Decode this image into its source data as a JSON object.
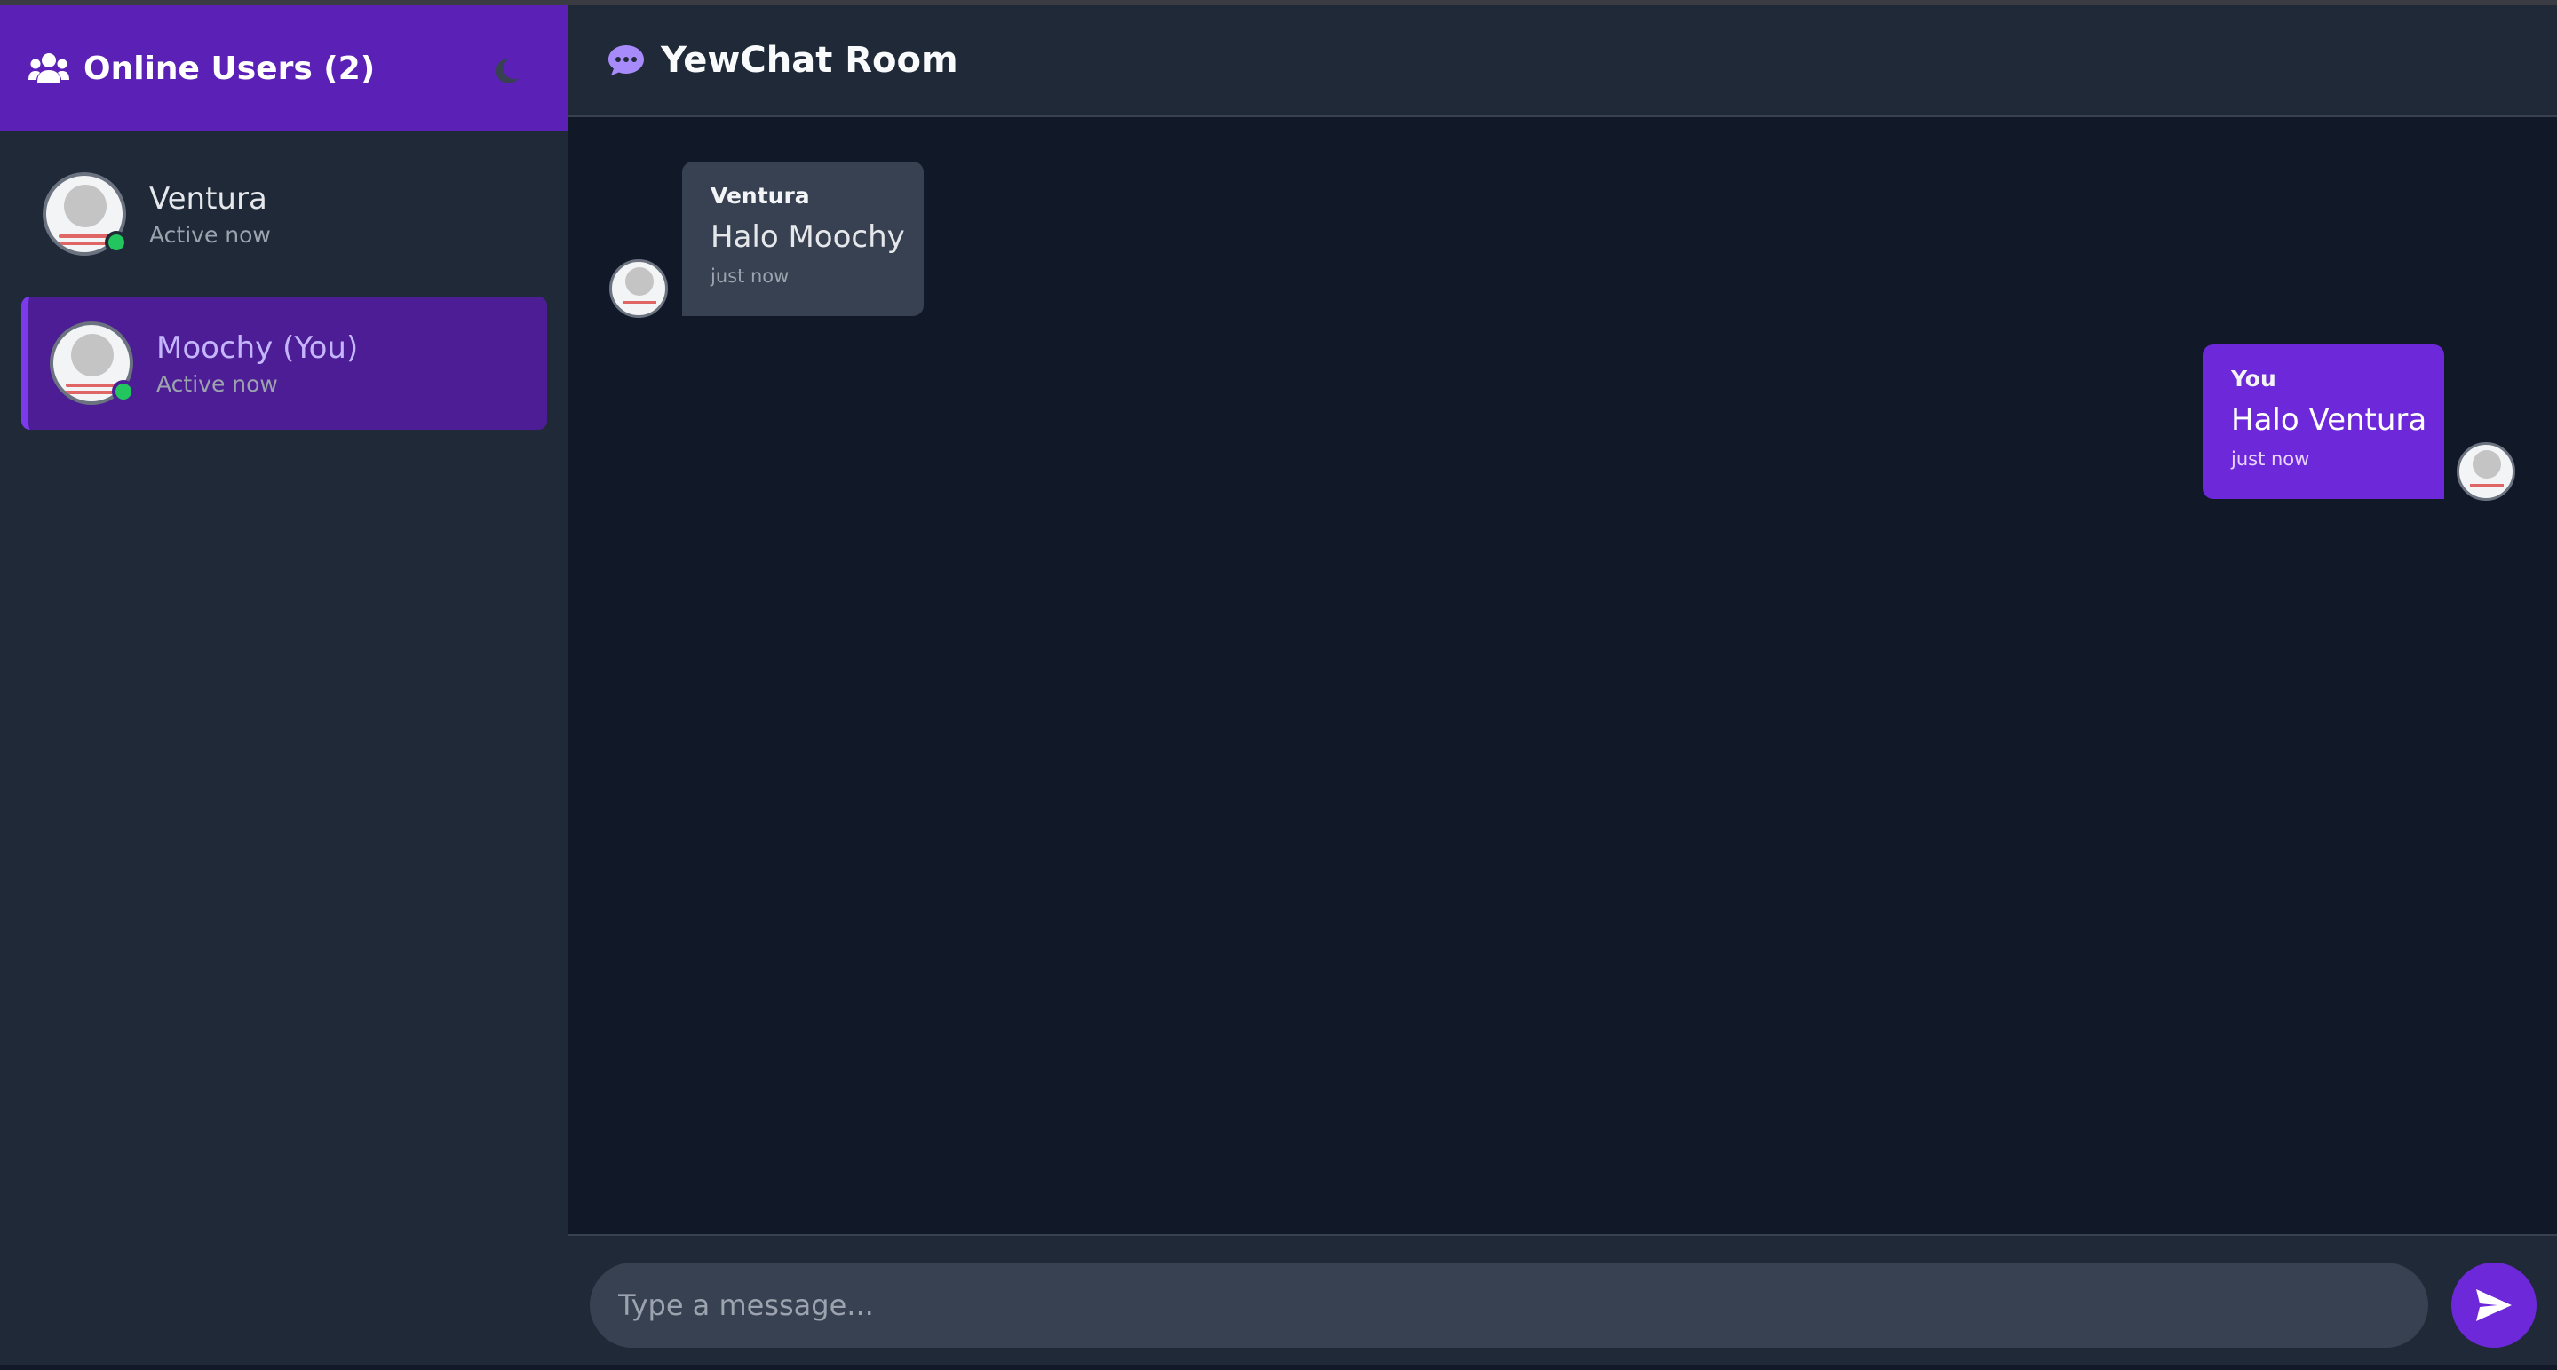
{
  "sidebar": {
    "title": "Online Users (2)",
    "users": [
      {
        "name": "Ventura",
        "status": "Active now",
        "selected": false
      },
      {
        "name": "Moochy (You)",
        "status": "Active now",
        "selected": true
      }
    ]
  },
  "chat": {
    "title": "YewChat Room",
    "messages": [
      {
        "sender": "Ventura",
        "text": "Halo Moochy",
        "time": "just now",
        "direction": "incoming"
      },
      {
        "sender": "You",
        "text": "Halo Ventura",
        "time": "just now",
        "direction": "outgoing"
      }
    ]
  },
  "composer": {
    "placeholder": "Type a message..."
  },
  "colors": {
    "accent": "#5b21b6",
    "outgoing_bubble": "#6d28d9",
    "incoming_bubble": "#374151",
    "online": "#22c55e",
    "background": "#111827",
    "panel": "#1f2937"
  },
  "icons": {
    "header": "users-icon",
    "theme_toggle": "moon-icon",
    "chat": "chat-bubble-icon",
    "send": "send-icon"
  }
}
